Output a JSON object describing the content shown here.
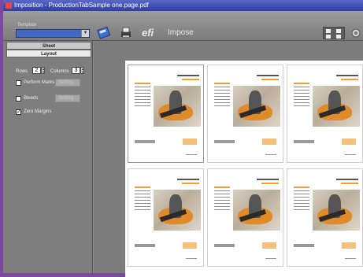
{
  "window": {
    "title": "Imposition - ProductionTabSample one.page.pdf"
  },
  "toolbar": {
    "template_label": "Template",
    "template_value": "",
    "efi_logo": "efi",
    "impose_label": "Impose",
    "icons": [
      "save-icon",
      "print-icon",
      "grid-layout-icon",
      "settings-icon"
    ]
  },
  "left_panel": {
    "tabs": [
      "Sheet",
      "Layout"
    ],
    "rows_label": "Rows",
    "rows_value": "2",
    "columns_label": "Columns",
    "columns_value": "3",
    "perform_marks_label": "Perform Marks",
    "perform_marks_checked": false,
    "perform_marks_button": "Setting...",
    "bleeds_label": "Bleeds",
    "bleeds_checked": false,
    "bleeds_button": "Setting...",
    "zero_margins_label": "Zero Margins",
    "zero_margins_checked": true
  },
  "colors": {
    "desktop": "#7a4a9e",
    "title_bar": "#2e3da3",
    "accent_orange": "#f0a030"
  }
}
